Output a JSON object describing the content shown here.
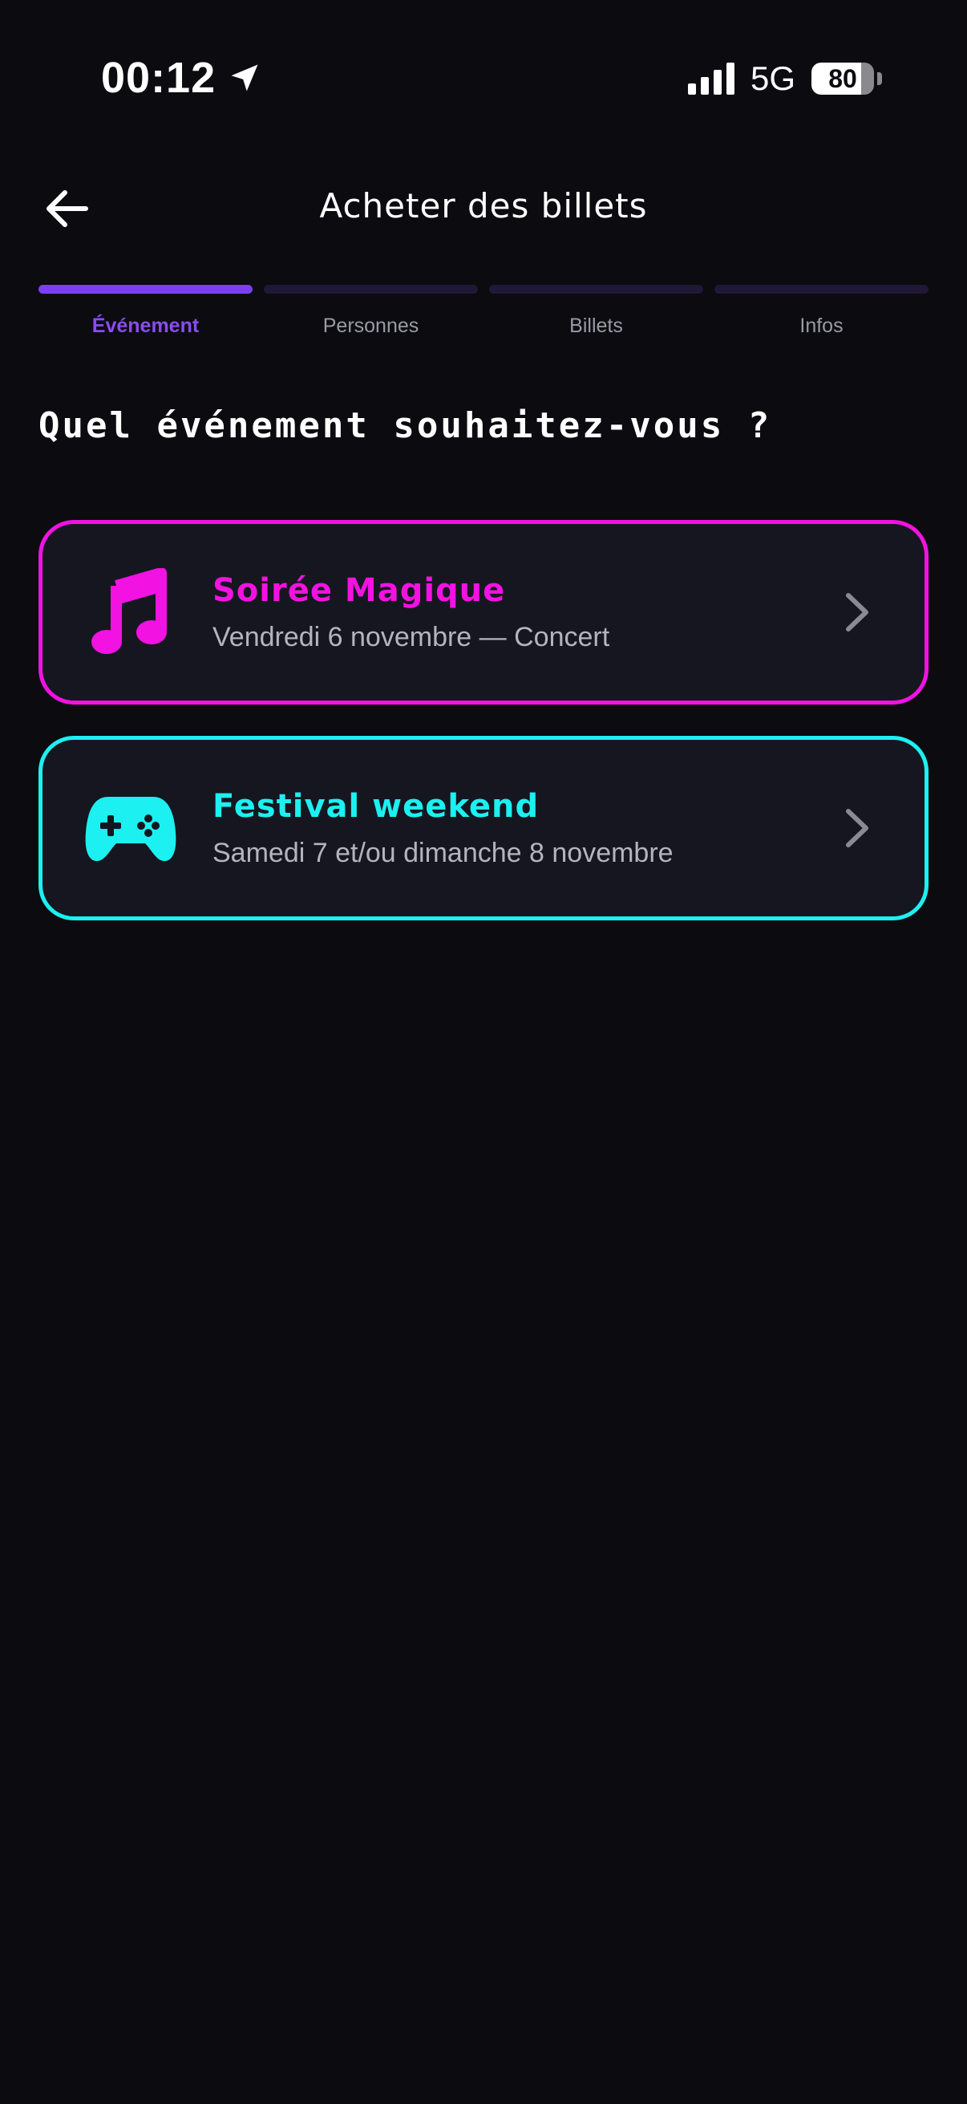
{
  "status_bar": {
    "time": "00:12",
    "network": "5G",
    "battery": "80",
    "battery_level": 0.8
  },
  "header": {
    "title": "Acheter des billets",
    "back_icon": "arrow-left-icon"
  },
  "stepper": {
    "steps": [
      {
        "label": "Événement",
        "active": true
      },
      {
        "label": "Personnes",
        "active": false
      },
      {
        "label": "Billets",
        "active": false
      },
      {
        "label": "Infos",
        "active": false
      }
    ]
  },
  "question": "Quel événement souhaitez-vous ?",
  "events": [
    {
      "title": "Soirée Magique",
      "subtitle": "Vendredi 6 novembre — Concert",
      "icon": "music-note-icon",
      "color": "#f212e2"
    },
    {
      "title": "Festival weekend",
      "subtitle": "Samedi 7 et/ou dimanche 8 novembre",
      "icon": "gamepad-icon",
      "color": "#1cf0f0"
    }
  ],
  "colors": {
    "background": "#0b0b10",
    "accent": "#7b3ff0",
    "card_background": "#161620"
  }
}
